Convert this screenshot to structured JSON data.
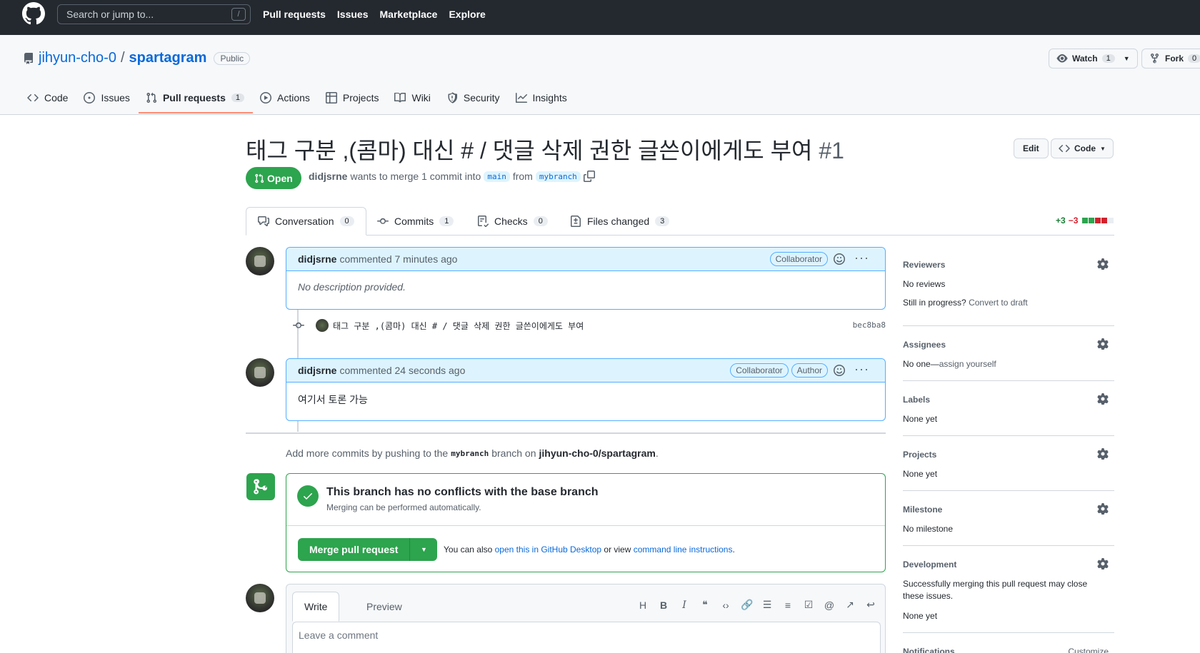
{
  "header": {
    "search_placeholder": "Search or jump to...",
    "search_key": "/",
    "nav": [
      "Pull requests",
      "Issues",
      "Marketplace",
      "Explore"
    ]
  },
  "repo": {
    "owner": "jihyun-cho-0",
    "separator": "/",
    "name": "spartagram",
    "visibility": "Public",
    "watch_label": "Watch",
    "watch_count": "1",
    "fork_label": "Fork",
    "fork_count": "0",
    "tabs": [
      {
        "label": "Code"
      },
      {
        "label": "Issues"
      },
      {
        "label": "Pull requests",
        "count": "1"
      },
      {
        "label": "Actions"
      },
      {
        "label": "Projects"
      },
      {
        "label": "Wiki"
      },
      {
        "label": "Security"
      },
      {
        "label": "Insights"
      }
    ]
  },
  "pr": {
    "title": "태그 구분 ,(콤마) 대신 # / 댓글 삭제 권한 글쓴이에게도 부여",
    "number": "#1",
    "edit_label": "Edit",
    "code_label": "Code",
    "state": "Open",
    "author": "didjsrne",
    "meta_text": "wants to merge 1 commit into",
    "base_branch": "main",
    "from_text": "from",
    "head_branch": "mybranch",
    "tabs": [
      {
        "label": "Conversation",
        "count": "0"
      },
      {
        "label": "Commits",
        "count": "1"
      },
      {
        "label": "Checks",
        "count": "0"
      },
      {
        "label": "Files changed",
        "count": "3"
      }
    ],
    "additions": "+3",
    "deletions": "−3"
  },
  "timeline": {
    "comment1": {
      "author": "didjsrne",
      "time": "commented 7 minutes ago",
      "roles": [
        "Collaborator"
      ],
      "body": "No description provided."
    },
    "commit": {
      "message": "태그 구분 ,(콤마) 대신 # / 댓글 삭제 권한 글쓴이에게도 부여",
      "sha": "bec8ba8"
    },
    "comment2": {
      "author": "didjsrne",
      "time": "commented 24 seconds ago",
      "roles": [
        "Collaborator",
        "Author"
      ],
      "body": "여기서 토론 가능"
    },
    "push_note": {
      "prefix": "Add more commits by pushing to the",
      "branch": "mybranch",
      "middle": "branch on",
      "repo": "jihyun-cho-0/spartagram",
      "suffix": "."
    },
    "merge": {
      "title": "This branch has no conflicts with the base branch",
      "subtitle": "Merging can be performed automatically.",
      "button": "Merge pull request",
      "alt_prefix": "You can also",
      "alt_link1": "open this in GitHub Desktop",
      "alt_middle": "or view",
      "alt_link2": "command line instructions",
      "alt_suffix": "."
    },
    "write": {
      "write_tab": "Write",
      "preview_tab": "Preview",
      "placeholder": "Leave a comment"
    }
  },
  "sidebar": {
    "reviewers": {
      "title": "Reviewers",
      "value": "No reviews",
      "note_prefix": "Still in progress?",
      "note_link": "Convert to draft"
    },
    "assignees": {
      "title": "Assignees",
      "value_prefix": "No one—",
      "value_link": "assign yourself"
    },
    "labels": {
      "title": "Labels",
      "value": "None yet"
    },
    "projects": {
      "title": "Projects",
      "value": "None yet"
    },
    "milestone": {
      "title": "Milestone",
      "value": "No milestone"
    },
    "development": {
      "title": "Development",
      "note": "Successfully merging this pull request may close these issues.",
      "value": "None yet"
    },
    "notifications": {
      "title": "Notifications",
      "action": "Customize"
    }
  }
}
